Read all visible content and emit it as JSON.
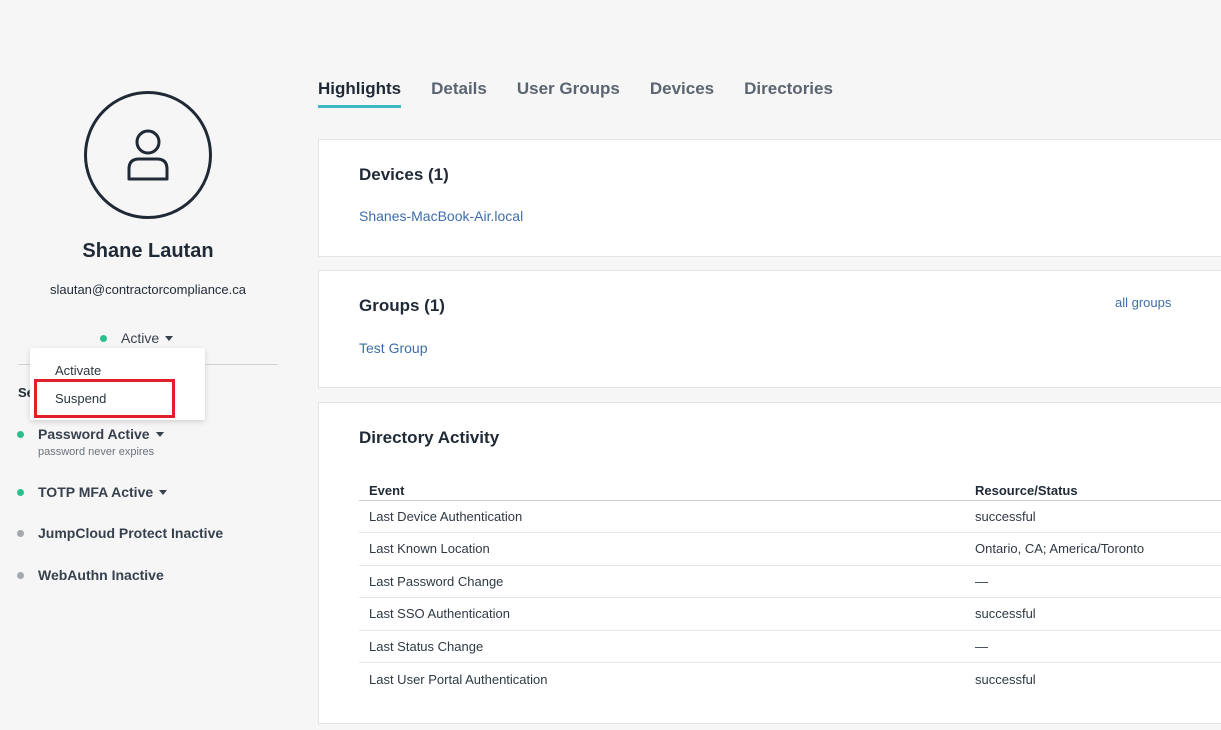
{
  "profile": {
    "name": "Shane Lautan",
    "email": "slautan@contractorcompliance.ca",
    "status": "Active",
    "section_heading_partial": "Se",
    "status_menu": [
      "Activate",
      "Suspend"
    ],
    "highlighted_option": "Suspend"
  },
  "auth": {
    "password": {
      "label": "Password Active",
      "note": "password never expires",
      "status": "active"
    },
    "totp": {
      "label": "TOTP MFA Active",
      "status": "active"
    },
    "protect": {
      "label": "JumpCloud Protect Inactive",
      "status": "inactive"
    },
    "webauthn": {
      "label": "WebAuthn Inactive",
      "status": "inactive"
    }
  },
  "tabs": [
    "Highlights",
    "Details",
    "User Groups",
    "Devices",
    "Directories"
  ],
  "active_tab": "Highlights",
  "devices": {
    "title": "Devices (1)",
    "items": [
      "Shanes-MacBook-Air.local"
    ]
  },
  "groups": {
    "title": "Groups (1)",
    "all_link": "all groups",
    "items": [
      "Test Group"
    ]
  },
  "activity": {
    "title": "Directory Activity",
    "columns": [
      "Event",
      "Resource/Status"
    ],
    "rows": [
      [
        "Last Device Authentication",
        "successful"
      ],
      [
        "Last Known Location",
        "Ontario, CA; America/Toronto"
      ],
      [
        "Last Password Change",
        "—"
      ],
      [
        "Last SSO Authentication",
        "successful"
      ],
      [
        "Last Status Change",
        "—"
      ],
      [
        "Last User Portal Authentication",
        "successful"
      ]
    ]
  },
  "colors": {
    "active_dot": "#2bbf8a",
    "inactive_dot": "#a5a9ae",
    "link": "#3e6dad",
    "tab_underline": "#3bb9c4",
    "highlight_box": "#e0202a"
  }
}
